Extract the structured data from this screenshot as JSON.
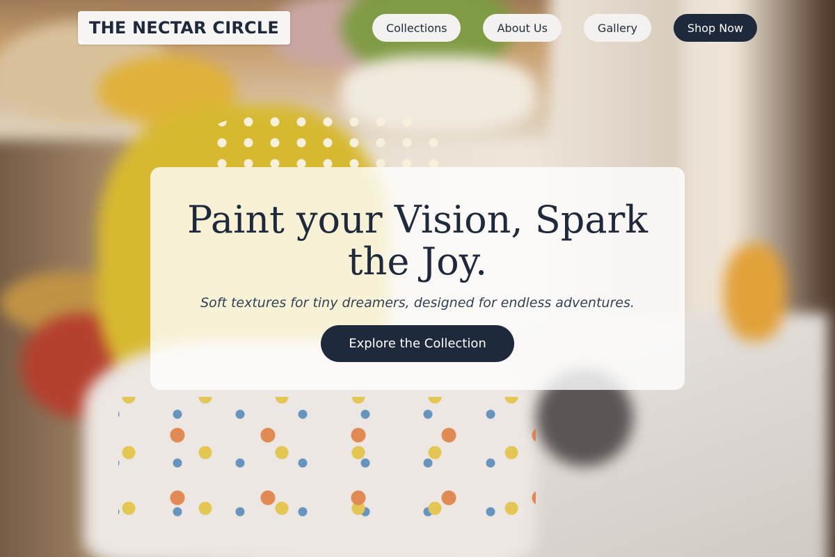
{
  "brand": {
    "name": "THE NECTAR CIRCLE"
  },
  "nav": {
    "items": [
      {
        "label": "Collections"
      },
      {
        "label": "About Us"
      },
      {
        "label": "Gallery"
      },
      {
        "label": "Shop Now"
      }
    ]
  },
  "hero": {
    "title": "Paint your Vision, Spark the Joy.",
    "subtitle": "Soft textures for tiny dreamers, designed for endless adventures.",
    "cta_label": "Explore the Collection",
    "background": "blurred-boutique-photo"
  },
  "colors": {
    "primary": "#1e293b",
    "pill_bg": "#f4f2f0",
    "card_bg": "rgba(255,255,255,0.80)"
  }
}
